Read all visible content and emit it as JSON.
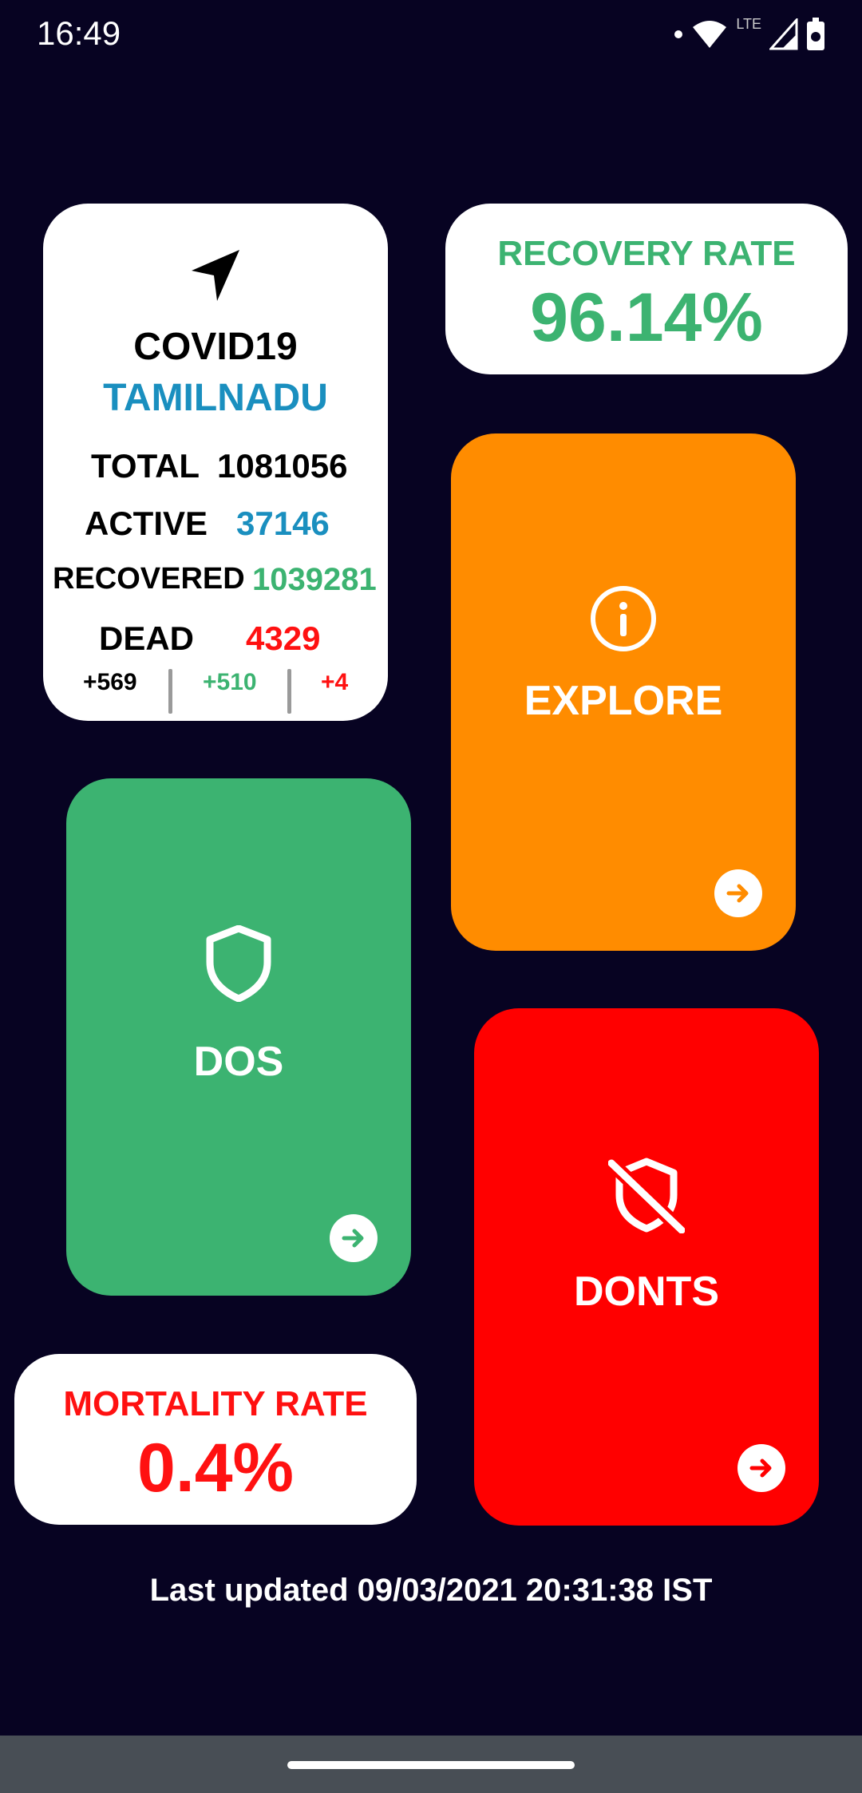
{
  "status_bar": {
    "time": "16:49",
    "network": "LTE",
    "icons": [
      "dot-icon",
      "wifi-icon",
      "signal-icon",
      "signal-icon-2",
      "battery-icon"
    ]
  },
  "stats": {
    "icon": "navigation-arrow-icon",
    "title": "COVID19",
    "region": "TAMILNADU",
    "total_label": "TOTAL",
    "total_value": "1081056",
    "active_label": "ACTIVE",
    "active_value": "37146",
    "recovered_label": "RECOVERED",
    "recovered_value": "1039281",
    "dead_label": "DEAD",
    "dead_value": "4329",
    "delta_total": "+569",
    "delta_recovered": "+510",
    "delta_dead": "+4"
  },
  "recovery": {
    "label": "RECOVERY RATE",
    "value": "96.14%"
  },
  "explore": {
    "label": "EXPLORE",
    "icon": "info-icon"
  },
  "dos": {
    "label": "DOS",
    "icon": "shield-icon"
  },
  "donts": {
    "label": "DONTS",
    "icon": "shield-off-icon"
  },
  "mortality": {
    "label": "MORTALITY RATE",
    "value": "0.4%"
  },
  "footer": {
    "last_updated": "Last updated 09/03/2021 20:31:38 IST"
  },
  "colors": {
    "background": "#070322",
    "blue": "#1a8fbf",
    "green": "#3cb371",
    "orange": "#ff8c00",
    "red": "#ff0000"
  }
}
